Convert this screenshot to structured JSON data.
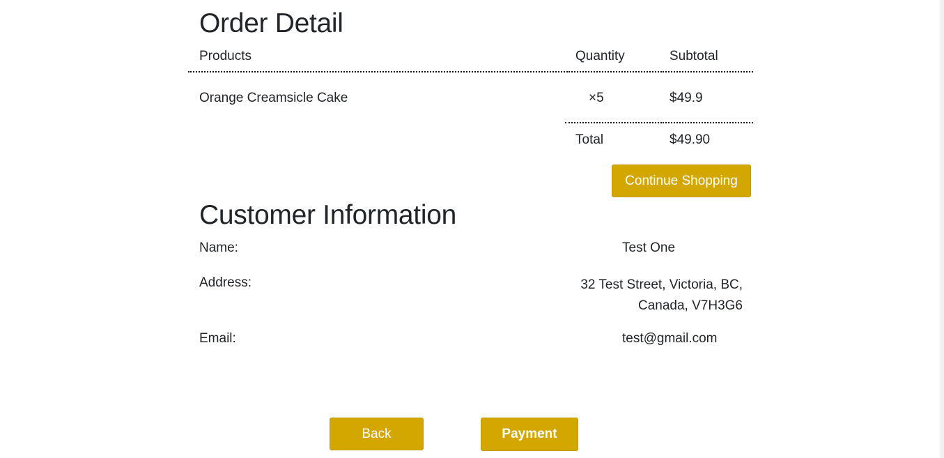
{
  "order": {
    "title": "Order Detail",
    "headers": {
      "products": "Products",
      "quantity": "Quantity",
      "subtotal": "Subtotal"
    },
    "items": [
      {
        "name": "Orange Creamsicle Cake",
        "quantity": "×5",
        "subtotal": "$49.9"
      }
    ],
    "total_label": "Total",
    "total_value": "$49.90",
    "continue_label": "Continue Shopping"
  },
  "customer": {
    "title": "Customer Information",
    "name_label": "Name:",
    "name_value": "Test One",
    "address_label": "Address:",
    "address_line1": "32 Test Street, Victoria, BC,",
    "address_line2": "Canada, V7H3G6",
    "email_label": "Email:",
    "email_value": "test@gmail.com"
  },
  "actions": {
    "back_label": "Back",
    "payment_label": "Payment"
  },
  "colors": {
    "button_bg": "#d4a600",
    "button_text": "#ffffff"
  }
}
